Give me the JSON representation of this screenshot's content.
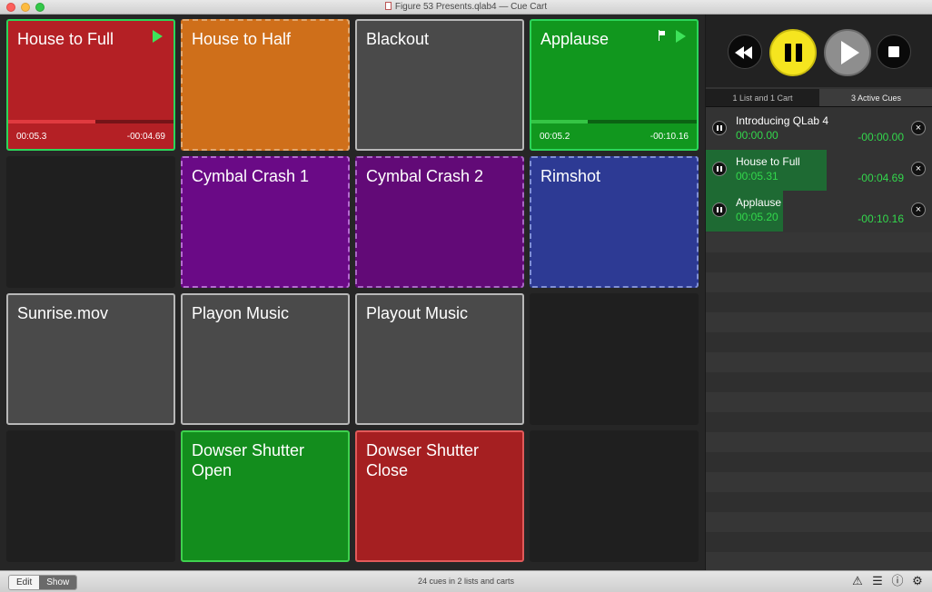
{
  "window": {
    "title": "Figure 53 Presents.qlab4 — Cue Cart"
  },
  "cart": {
    "tiles": [
      {
        "id": "house-to-full",
        "name": "House to Full",
        "color": "#b42025",
        "active": true,
        "progress": 0.53,
        "elapsed": "00:05.3",
        "remaining": "-00:04.69"
      },
      {
        "id": "house-to-half",
        "name": "House to Half",
        "color": "#cf6f1a"
      },
      {
        "id": "blackout",
        "name": "Blackout",
        "color": "#4a4a4a"
      },
      {
        "id": "applause",
        "name": "Applause",
        "color": "#11971e",
        "active": true,
        "progress": 0.34,
        "elapsed": "00:05.2",
        "remaining": "-00:10.16"
      },
      {
        "id": "cymbal-crash-1",
        "name": "Cymbal Crash 1",
        "color": "#6a0a86"
      },
      {
        "id": "cymbal-crash-2",
        "name": "Cymbal Crash 2",
        "color": "#620a77"
      },
      {
        "id": "rimshot",
        "name": "Rimshot",
        "color": "#2d3a94"
      },
      {
        "id": "sunrise-mov",
        "name": "Sunrise.mov",
        "color": "#4a4a4a"
      },
      {
        "id": "playon-music",
        "name": "Playon Music",
        "color": "#4a4a4a"
      },
      {
        "id": "playout-music",
        "name": "Playout Music",
        "color": "#4a4a4a"
      },
      {
        "id": "dowser-shutter-open",
        "name": "Dowser Shutter\nOpen",
        "color": "#138d1d"
      },
      {
        "id": "dowser-shutter-close",
        "name": "Dowser Shutter\nClose",
        "color": "#a51f21"
      }
    ]
  },
  "panel": {
    "tabs": [
      {
        "label": "1 List and 1 Cart",
        "selected": false
      },
      {
        "label": "3 Active Cues",
        "selected": true
      }
    ],
    "active_cues": [
      {
        "name": "Introducing QLab 4",
        "elapsed": "00:00.00",
        "remaining": "-00:00.00",
        "progress": 0.0
      },
      {
        "name": "House to Full",
        "elapsed": "00:05.31",
        "remaining": "-00:04.69",
        "progress": 0.53
      },
      {
        "name": "Applause",
        "elapsed": "00:05.20",
        "remaining": "-00:10.16",
        "progress": 0.34
      }
    ]
  },
  "statusbar": {
    "edit_label": "Edit",
    "show_label": "Show",
    "status_text": "24 cues in 2 lists and carts"
  }
}
